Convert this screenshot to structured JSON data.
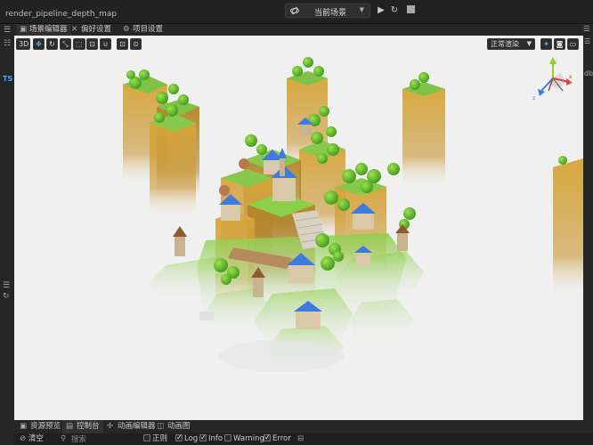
{
  "app": {
    "title": "render_pipeline_depth_map"
  },
  "toolbar": {
    "scene_selector": "当前场景"
  },
  "tabs": [
    {
      "label": "场景编辑器",
      "icon": "scene-icon"
    },
    {
      "label": "偏好设置",
      "icon": "wrench-icon"
    },
    {
      "label": "项目设置",
      "icon": "settings-icon"
    }
  ],
  "viewport": {
    "mode_3d": "3D",
    "render_mode": "正常渲染",
    "gizmo_axes": [
      "x",
      "y",
      "z"
    ],
    "colors": {
      "x_axis": "#e0453d",
      "y_axis": "#8bd02f",
      "z_axis": "#3d7be0"
    }
  },
  "left_panel": {
    "script_badge": "TS"
  },
  "right_panel": {
    "label": "db"
  },
  "bottom_tabs": [
    {
      "label": "资源预览",
      "icon": "preview-icon"
    },
    {
      "label": "控制台",
      "icon": "console-icon"
    },
    {
      "label": "动画编辑器",
      "icon": "animation-icon"
    },
    {
      "label": "动画图",
      "icon": "graph-icon"
    }
  ],
  "console": {
    "clear_label": "清空",
    "search_placeholder": "搜索",
    "filters": [
      {
        "label": "正则",
        "checked": false
      },
      {
        "label": "Log",
        "checked": true
      },
      {
        "label": "Info",
        "checked": true
      },
      {
        "label": "Warning",
        "checked": false
      },
      {
        "label": "Error",
        "checked": true
      }
    ]
  }
}
